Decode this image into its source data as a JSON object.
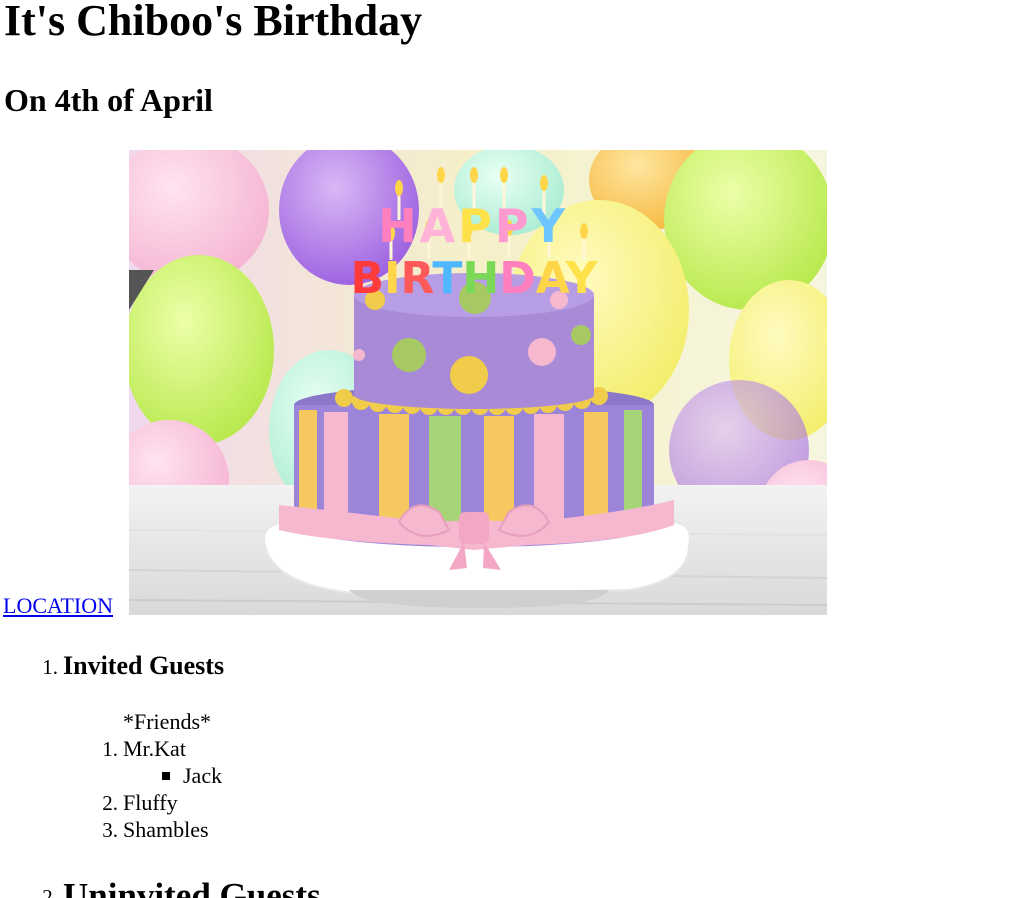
{
  "header": {
    "title": "It's Chiboo's Birthday",
    "subtitle": "On 4th of April"
  },
  "location_link": "LOCATION",
  "image": {
    "banner_text_top": "HAPPY",
    "banner_text_bottom": "BIRTHDAY"
  },
  "sections": [
    {
      "number": "1.",
      "heading": "Invited Guests",
      "group_label": "*Friends*",
      "guests": [
        {
          "number": "1.",
          "name": "Mr.Kat",
          "sub": [
            "Jack"
          ]
        },
        {
          "number": "2.",
          "name": "Fluffy"
        },
        {
          "number": "3.",
          "name": "Shambles"
        }
      ]
    },
    {
      "number": "2.",
      "heading": "Uninvited Guests"
    }
  ],
  "colors": {
    "link": "#0000ee",
    "cake_top": "#a88ad6",
    "cake_bottom": "#9c85d8",
    "ribbon": "#f6b8cf"
  }
}
